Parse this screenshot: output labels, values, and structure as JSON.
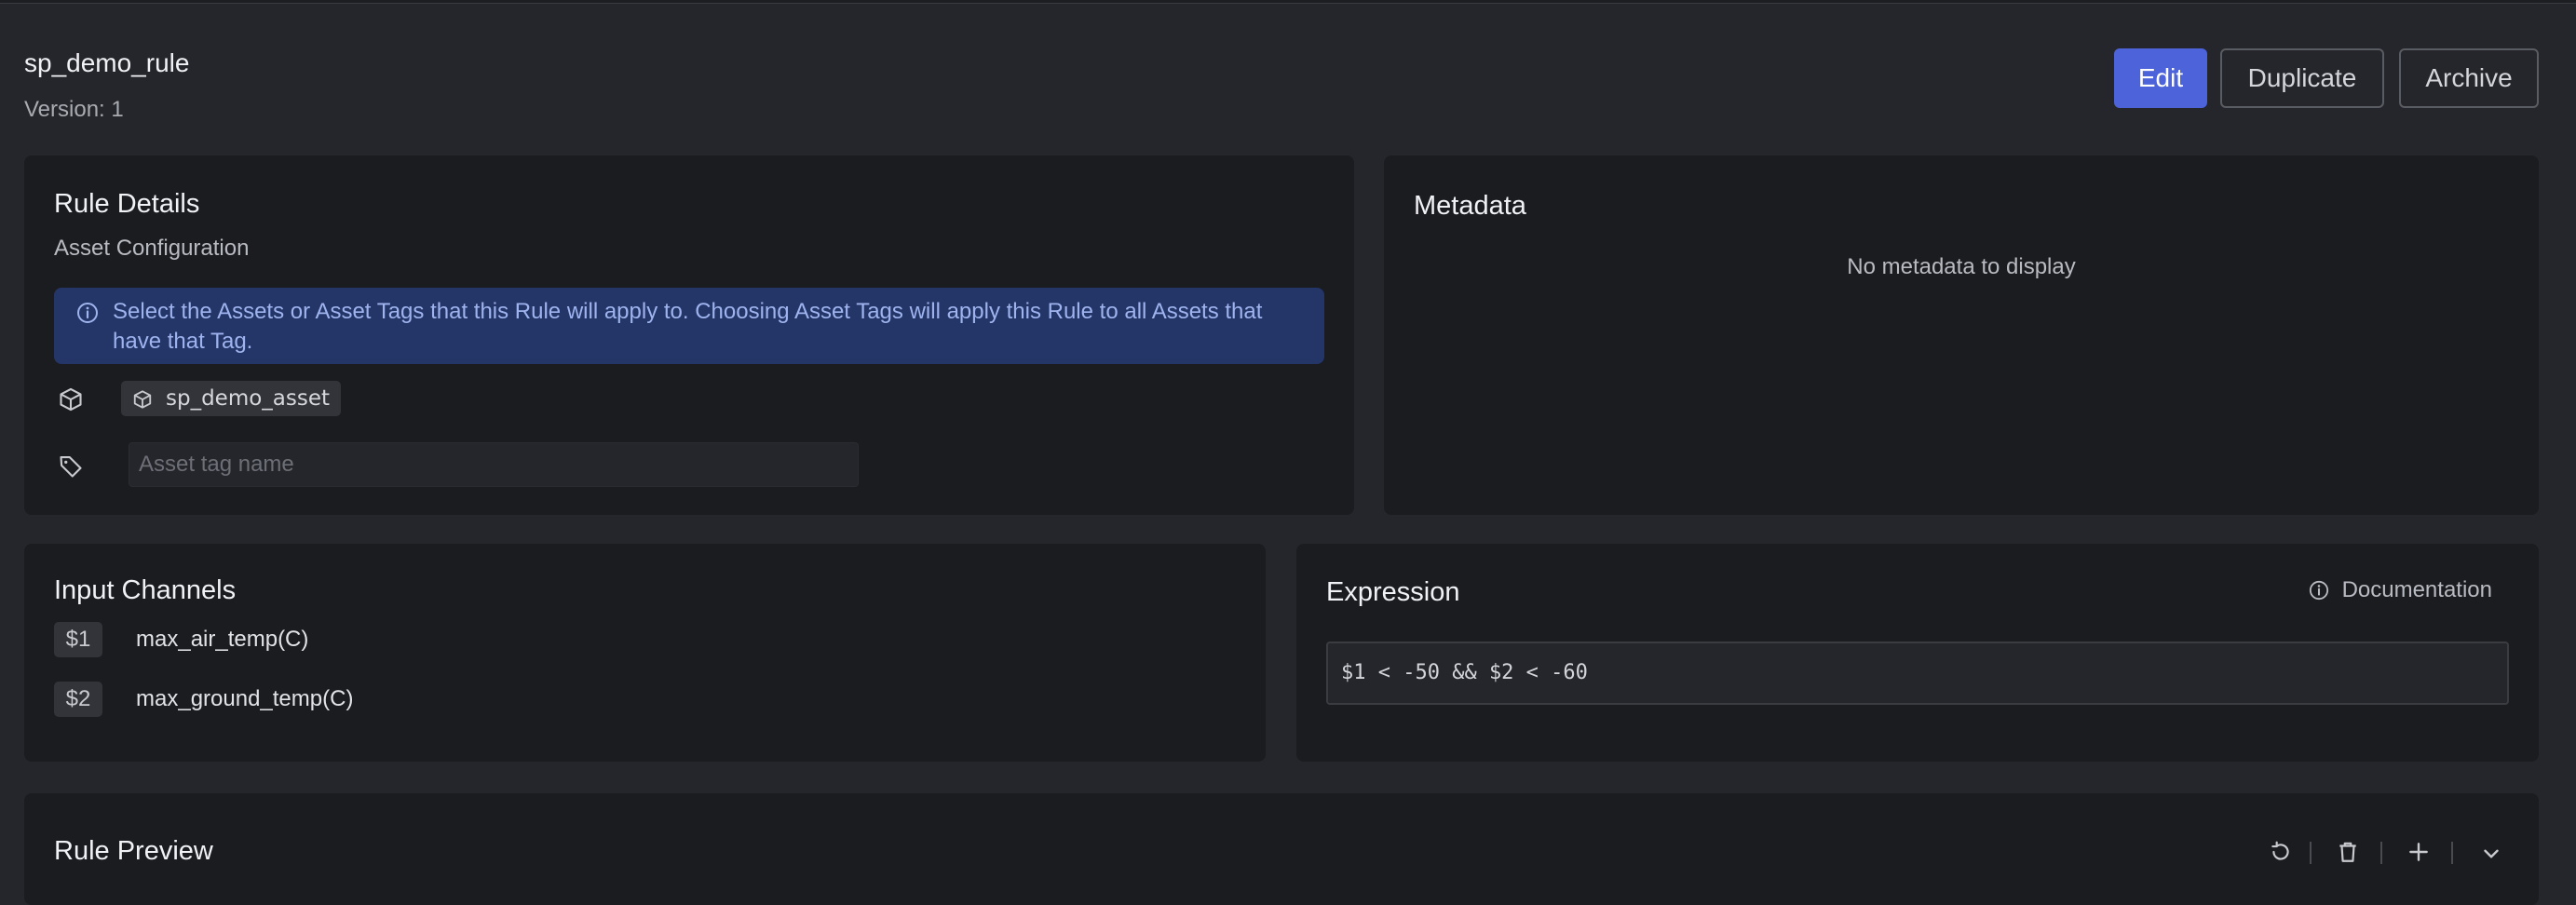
{
  "header": {
    "title": "sp_demo_rule",
    "version": "Version: 1",
    "buttons": {
      "edit": "Edit",
      "duplicate": "Duplicate",
      "archive": "Archive"
    }
  },
  "rule_details": {
    "title": "Rule Details",
    "subtitle": "Asset Configuration",
    "info_text": "Select the Assets or Asset Tags that this Rule will apply to. Choosing Asset Tags will apply this Rule to all Assets that have that Tag.",
    "asset": "sp_demo_asset",
    "tag_placeholder": "Asset tag name"
  },
  "metadata": {
    "title": "Metadata",
    "empty_text": "No metadata to display"
  },
  "input_channels": {
    "title": "Input Channels",
    "channels": [
      {
        "var": "$1",
        "name": "max_air_temp(C)"
      },
      {
        "var": "$2",
        "name": "max_ground_temp(C)"
      }
    ]
  },
  "expression": {
    "title": "Expression",
    "documentation_label": "Documentation",
    "value": "$1 < -50 && $2 < -60"
  },
  "rule_preview": {
    "title": "Rule Preview",
    "tool_icons": [
      "undo-icon",
      "trash-icon",
      "plus-icon",
      "chevron-down-icon"
    ]
  },
  "colors": {
    "accent": "#4c63d9",
    "page_bg": "#25262b",
    "card_bg": "#1b1c20",
    "info_bg": "#243567"
  }
}
